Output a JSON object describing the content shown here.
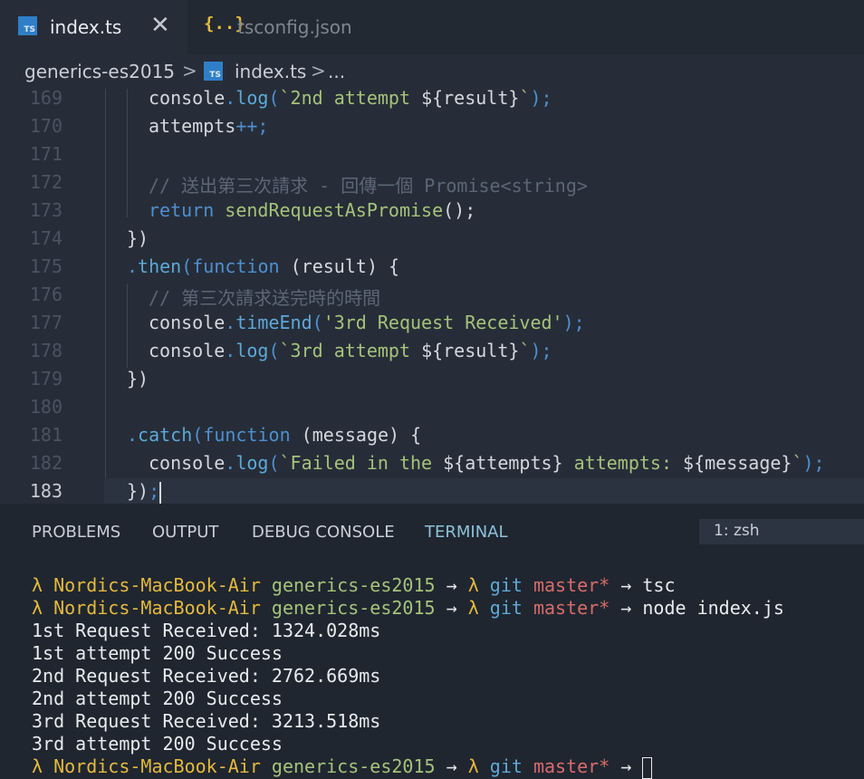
{
  "tabs": {
    "active": {
      "icon": "typescript-file-icon",
      "icon_text": "TS",
      "label": "index.ts",
      "close_symbol": "✕"
    },
    "inactive": {
      "icon": "json-file-icon",
      "icon_text": "{..}",
      "label": "tsconfig.json"
    }
  },
  "breadcrumb": {
    "folder": "generics-es2015",
    "sep": ">",
    "file_icon_text": "TS",
    "file": "index.ts",
    "more": "..."
  },
  "editor": {
    "current_line": "183",
    "lines": [
      {
        "num": "169"
      },
      {
        "num": "170"
      },
      {
        "num": "171"
      },
      {
        "num": "172"
      },
      {
        "num": "173"
      },
      {
        "num": "174"
      },
      {
        "num": "175"
      },
      {
        "num": "176"
      },
      {
        "num": "177"
      },
      {
        "num": "178"
      },
      {
        "num": "179"
      },
      {
        "num": "180"
      },
      {
        "num": "181"
      },
      {
        "num": "182"
      },
      {
        "num": "183"
      }
    ],
    "tokens": {
      "l169": [
        "console",
        ".",
        "log",
        "(",
        "`2nd attempt ",
        "${result}",
        "`",
        ");"
      ],
      "l170": [
        "attempts",
        "++;"
      ],
      "l172": [
        "// 送出第三次請求 - 回傳一個 Promise<string>"
      ],
      "l173": [
        "return",
        " ",
        "sendRequestAsPromise",
        "();"
      ],
      "l174": [
        "})"
      ],
      "l175": [
        ".",
        "then",
        "(",
        "function",
        " (",
        "result",
        ") {"
      ],
      "l176": [
        "// 第三次請求送完時的時間"
      ],
      "l177": [
        "console",
        ".",
        "timeEnd",
        "(",
        "'3rd Request Received'",
        ");"
      ],
      "l178": [
        "console",
        ".",
        "log",
        "(",
        "`3rd attempt ",
        "${result}",
        "`",
        ");"
      ],
      "l179": [
        "})"
      ],
      "l181": [
        ".",
        "catch",
        "(",
        "function",
        " (",
        "message",
        ") {"
      ],
      "l182": [
        "console",
        ".",
        "log",
        "(",
        "`Failed in the ",
        "${attempts}",
        " attempts: ",
        "${message}",
        "`",
        ");"
      ],
      "l183": [
        "})",
        ";"
      ]
    }
  },
  "panel": {
    "tabs": [
      "PROBLEMS",
      "OUTPUT",
      "DEBUG CONSOLE",
      "TERMINAL"
    ],
    "active_tab": "TERMINAL",
    "terminal_select": "1: zsh",
    "prompt": {
      "lambda": "λ",
      "host": "Nordics-MacBook-Air",
      "dir": "generics-es2015",
      "arrow": "→",
      "git": "git",
      "branch": "master*"
    },
    "commands": [
      "tsc",
      "node index.js",
      ""
    ],
    "output": [
      "1st Request Received: 1324.028ms",
      "1st attempt 200 Success",
      "2nd Request Received: 2762.669ms",
      "2nd attempt 200 Success",
      "3rd Request Received: 3213.518ms",
      "3rd attempt 200 Success"
    ]
  },
  "colors": {
    "background": "#262d38",
    "tabbar": "#222933",
    "panel": "#1f2630",
    "keyword": "#4f8fd0",
    "property": "#5ea8d8",
    "string": "#a5c37a",
    "comment": "#5c6676",
    "prompt_yellow": "#e5b93c",
    "branch_red": "#d96b6b",
    "terminal_active_tab": "#8ec2d8"
  }
}
